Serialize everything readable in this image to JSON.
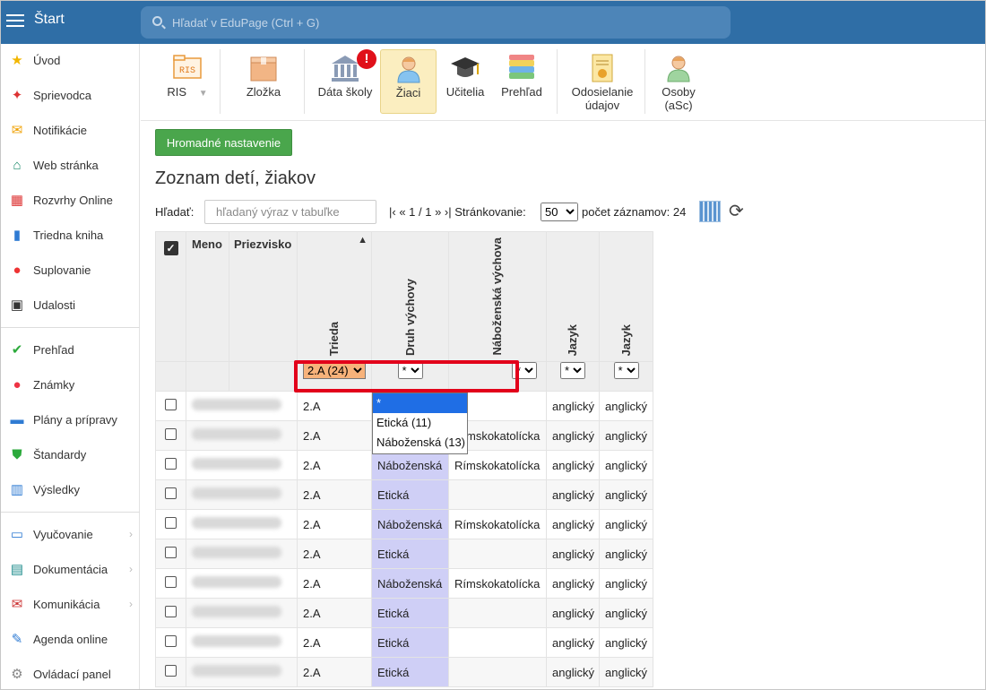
{
  "topbar": {
    "title": "Štart",
    "search_placeholder": "Hľadať v EduPage (Ctrl + G)"
  },
  "sidebar": {
    "items": [
      {
        "label": "Úvod",
        "icon": "star-icon",
        "color": "#f2b600"
      },
      {
        "label": "Sprievodca",
        "icon": "magic-wand-icon",
        "color": "#d33"
      },
      {
        "label": "Notifikácie",
        "icon": "envelope-icon",
        "color": "#f0a000"
      },
      {
        "label": "Web stránka",
        "icon": "home-icon",
        "color": "#1a8a6a"
      },
      {
        "label": "Rozvrhy Online",
        "icon": "calendar-grid-icon",
        "color": "#d33"
      },
      {
        "label": "Triedna kniha",
        "icon": "book-icon",
        "color": "#2f7bd3"
      },
      {
        "label": "Suplovanie",
        "icon": "user-substitute-icon",
        "color": "#e33"
      },
      {
        "label": "Udalosti",
        "icon": "calendar-icon",
        "color": "#333"
      },
      {
        "label": "Prehľad",
        "icon": "check-circle-icon",
        "color": "#2caa3c"
      },
      {
        "label": "Známky",
        "icon": "grade-icon",
        "color": "#e34"
      },
      {
        "label": "Plány a prípravy",
        "icon": "briefcase-icon",
        "color": "#2f7bd3"
      },
      {
        "label": "Štandardy",
        "icon": "shield-check-icon",
        "color": "#2caa3c"
      },
      {
        "label": "Výsledky",
        "icon": "bar-chart-icon",
        "color": "#2f7bd3"
      },
      {
        "label": "Vyučovanie",
        "icon": "open-book-icon",
        "color": "#2f7bd3"
      },
      {
        "label": "Dokumentácia",
        "icon": "document-icon",
        "color": "#1a8a8a"
      },
      {
        "label": "Komunikácia",
        "icon": "chat-icon",
        "color": "#c33"
      },
      {
        "label": "Agenda online",
        "icon": "pen-icon",
        "color": "#2f7bd3"
      },
      {
        "label": "Ovládací panel",
        "icon": "gear-icon",
        "color": "#888"
      }
    ]
  },
  "toolbar": {
    "ris": "RIS",
    "ris_icon_text": "RIS",
    "zlozka": "Zložka",
    "data_skoly": "Dáta školy",
    "ziaci": "Žiaci",
    "ucitelia": "Učitelia",
    "prehlad": "Prehľad",
    "odosielanie_1": "Odosielanie",
    "odosielanie_2": "údajov",
    "osoby_1": "Osoby",
    "osoby_2": "(aSc)",
    "alert": "!"
  },
  "main": {
    "bulk_button": "Hromadné nastavenie",
    "title": "Zoznam detí, žiakov",
    "search_label": "Hľadať:",
    "search_placeholder": "hľadaný výraz v tabuľke",
    "pager": "|‹ « 1 / 1 » ›|",
    "paging_label": "Stránkovanie:",
    "per_page": "50",
    "record_count": "počet záznamov: 24"
  },
  "table": {
    "headers": {
      "meno": "Meno",
      "priezvisko": "Priezvisko",
      "trieda": "Trieda",
      "druh": "Druh výchovy",
      "nabozenska": "Náboženská výchova",
      "jazyk1": "Jazyk",
      "jazyk2": "Jazyk",
      "sort_arrow": "▲"
    },
    "filters": {
      "trieda": "2.A (24)",
      "druh": "*",
      "nabozenska": "*",
      "jazyk1": "*",
      "jazyk2": "*"
    },
    "rows": [
      {
        "trieda": "2.A",
        "druh": "",
        "nab": "",
        "j1": "anglický",
        "j2": "anglický"
      },
      {
        "trieda": "2.A",
        "druh": "",
        "nab": "Rímskokatolícka",
        "j1": "anglický",
        "j2": "anglický"
      },
      {
        "trieda": "2.A",
        "druh": "Náboženská",
        "nab": "Rímskokatolícka",
        "j1": "anglický",
        "j2": "anglický"
      },
      {
        "trieda": "2.A",
        "druh": "Etická",
        "nab": "",
        "j1": "anglický",
        "j2": "anglický"
      },
      {
        "trieda": "2.A",
        "druh": "Náboženská",
        "nab": "Rímskokatolícka",
        "j1": "anglický",
        "j2": "anglický"
      },
      {
        "trieda": "2.A",
        "druh": "Etická",
        "nab": "",
        "j1": "anglický",
        "j2": "anglický"
      },
      {
        "trieda": "2.A",
        "druh": "Náboženská",
        "nab": "Rímskokatolícka",
        "j1": "anglický",
        "j2": "anglický"
      },
      {
        "trieda": "2.A",
        "druh": "Etická",
        "nab": "",
        "j1": "anglický",
        "j2": "anglický"
      },
      {
        "trieda": "2.A",
        "druh": "Etická",
        "nab": "",
        "j1": "anglický",
        "j2": "anglický"
      },
      {
        "trieda": "2.A",
        "druh": "Etická",
        "nab": "",
        "j1": "anglický",
        "j2": "anglický"
      }
    ]
  },
  "dropdown": {
    "options": [
      "*",
      "Etická (11)",
      "Náboženská (13)"
    ]
  }
}
